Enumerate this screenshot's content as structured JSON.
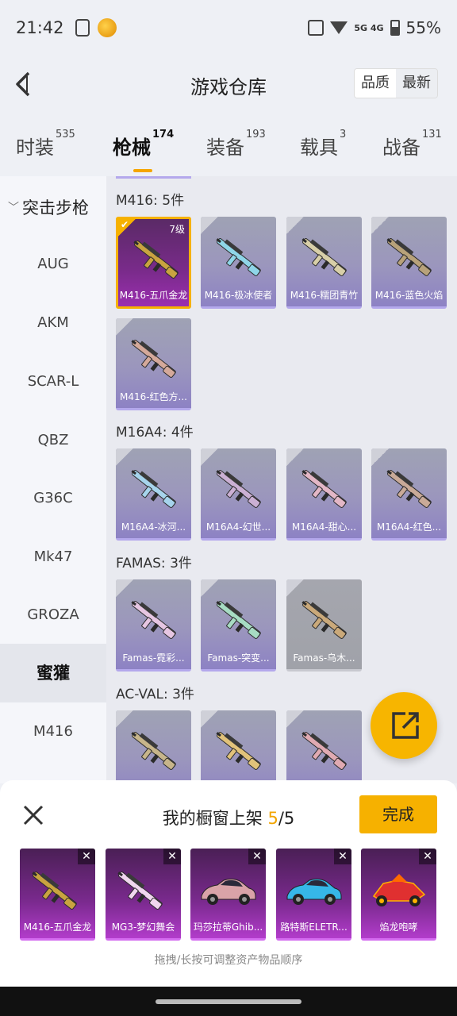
{
  "status": {
    "time": "21:42",
    "network": "5G 4G",
    "battery": "55%"
  },
  "header": {
    "title": "游戏仓库",
    "sort_quality": "品质",
    "sort_latest": "最新"
  },
  "tabs": [
    {
      "label": "时装",
      "count": "535"
    },
    {
      "label": "枪械",
      "count": "174",
      "active": true
    },
    {
      "label": "装备",
      "count": "193"
    },
    {
      "label": "载具",
      "count": "3"
    },
    {
      "label": "战备",
      "count": "131"
    }
  ],
  "sidebar": {
    "category": "突击步枪",
    "items": [
      "AUG",
      "AKM",
      "SCAR-L",
      "QBZ",
      "G36C",
      "Mk47",
      "GROZA",
      "蜜獾",
      "M416"
    ],
    "active": "蜜獾"
  },
  "groups": [
    {
      "title": "M416: 5件",
      "items": [
        {
          "name": "M416-五爪金龙",
          "level": "7级",
          "selected": true,
          "gun_color": "#c9a340"
        },
        {
          "name": "M416-极冰使者",
          "gun_color": "#8fd6e8"
        },
        {
          "name": "M416-糯团青竹",
          "gun_color": "#d8cfa8"
        },
        {
          "name": "M416-蓝色火焰",
          "gun_color": "#b8a27a"
        },
        {
          "name": "M416-红色方...",
          "gun_color": "#d4a99a"
        }
      ]
    },
    {
      "title": "M16A4: 4件",
      "items": [
        {
          "name": "M16A4-冰河...",
          "gun_color": "#a6d4ec"
        },
        {
          "name": "M16A4-幻世...",
          "gun_color": "#cbb0d4"
        },
        {
          "name": "M16A4-甜心...",
          "gun_color": "#e3b7c6"
        },
        {
          "name": "M16A4-红色...",
          "gun_color": "#c9aa98"
        }
      ]
    },
    {
      "title": "FAMAS: 3件",
      "items": [
        {
          "name": "Famas-霓彩...",
          "gun_color": "#e6c6e2"
        },
        {
          "name": "Famas-突变...",
          "gun_color": "#a7dcc3"
        },
        {
          "name": "Famas-乌木...",
          "gun_color": "#caa97a",
          "grey": true
        }
      ]
    },
    {
      "title": "AC-VAL: 3件",
      "items": [
        {
          "name": "",
          "gun_color": "#c7b58a"
        },
        {
          "name": "",
          "gun_color": "#e1c27a"
        },
        {
          "name": "",
          "gun_color": "#e0aab2"
        }
      ]
    }
  ],
  "sheet": {
    "title_prefix": "我的橱窗上架 ",
    "count": "5",
    "total": "/5",
    "done": "完成",
    "hint": "拖拽/长按可调整资产物品顺序",
    "items": [
      {
        "name": "M416-五爪金龙",
        "kind": "gun",
        "color": "#c9a340"
      },
      {
        "name": "MG3-梦幻舞会",
        "kind": "gun",
        "color": "#f0d6ef"
      },
      {
        "name": "玛莎拉蒂Ghib...",
        "kind": "car",
        "color": "#d9a3a8"
      },
      {
        "name": "路特斯ELETR...",
        "kind": "car",
        "color": "#36b7e8"
      },
      {
        "name": "焰龙咆哮",
        "kind": "kart",
        "color": "#e03030"
      }
    ]
  }
}
